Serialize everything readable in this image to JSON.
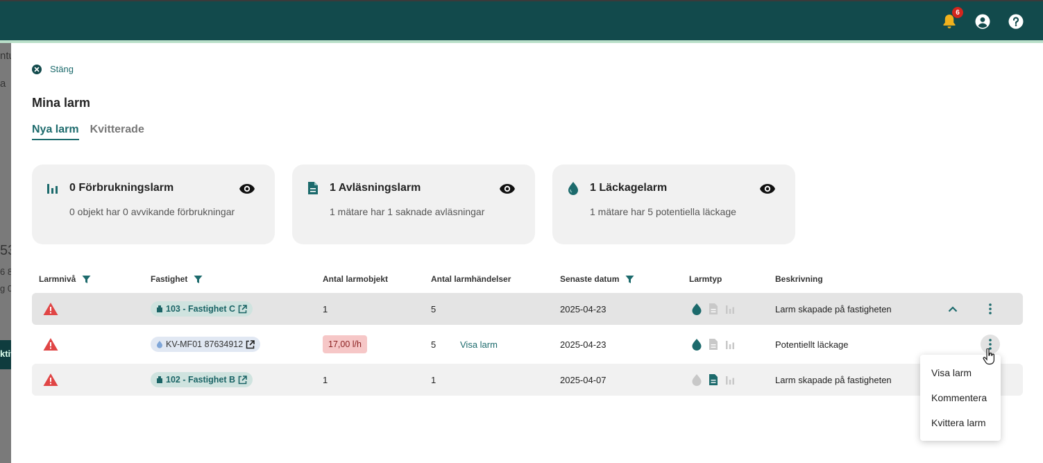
{
  "topbar": {
    "notification_count": "6",
    "icons": [
      "bell-icon",
      "account-icon",
      "help-icon"
    ]
  },
  "background_page": {
    "fragments": [
      "ntu",
      "a",
      "53",
      "6 8",
      "g 0",
      "ktiv"
    ]
  },
  "panel": {
    "close_label": "Stäng",
    "title": "Mina larm",
    "tabs": [
      {
        "label": "Nya larm",
        "active": true
      },
      {
        "label": "Kvitterade",
        "active": false
      }
    ]
  },
  "summary_cards": [
    {
      "icon": "bar-chart-icon",
      "title": "0 Förbrukningslarm",
      "subtitle": "0 objekt har 0 avvikande förbrukningar"
    },
    {
      "icon": "document-icon",
      "title": "1 Avläsningslarm",
      "subtitle": "1 mätare har 1 saknade avläsningar"
    },
    {
      "icon": "water-drop-icon",
      "title": "1 Läckagelarm",
      "subtitle": "1 mätare har 5 potentiella läckage"
    }
  ],
  "table": {
    "headers": {
      "level": "Larmnivå",
      "property": "Fastighet",
      "objects": "Antal larmobjekt",
      "events": "Antal larmhändelser",
      "latest": "Senaste datum",
      "type": "Larmtyp",
      "description": "Beskrivning"
    },
    "rows": [
      {
        "property": "103 - Fastighet C",
        "objects": "1",
        "events": "5",
        "latest": "2025-04-23",
        "description": "Larm skapade på fastigheten",
        "active_types": [
          "leak"
        ],
        "expanded": true
      },
      {
        "meter": "KV-MF01 87634912",
        "flow": "17,00 l/h",
        "events": "5",
        "link": "Visa larm",
        "latest": "2025-04-23",
        "description": "Potentiellt läckage",
        "active_types": [
          "leak"
        ]
      },
      {
        "property": "102 - Fastighet B",
        "objects": "1",
        "events": "1",
        "latest": "2025-04-07",
        "description": "Larm skapade på fastigheten",
        "active_types": [
          "reading"
        ]
      }
    ]
  },
  "context_menu": {
    "items": [
      "Visa larm",
      "Kommentera",
      "Kvittera larm"
    ]
  },
  "colors": {
    "topbar": "#124a4c",
    "accent": "#1c6a6c",
    "warning": "#e04545",
    "bell": "#f2b21c"
  }
}
